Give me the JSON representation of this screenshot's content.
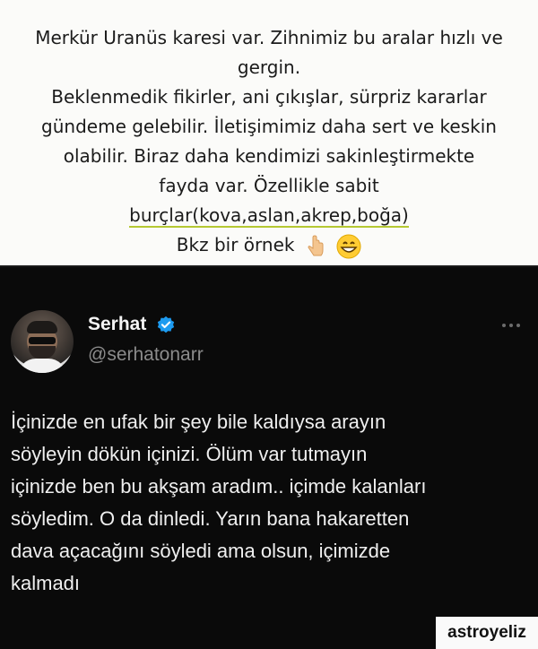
{
  "top_card": {
    "line1": "Merkür Uranüs karesi var. Zihnimiz bu aralar hızlı ve",
    "line2": "gergin.",
    "line3": "Beklenmedik fikirler, ani çıkışlar, sürpriz kararlar",
    "line4": "gündeme gelebilir. İletişimimiz daha sert ve keskin",
    "line5": "olabilir. Biraz daha kendimizi sakinleştirmekte",
    "line6": "fayda var. Özellikle sabit",
    "line7": "burçlar(kova,aslan,akrep,boğa)",
    "line8": "Bkz bir örnek",
    "emoji1": "point-down-emoji",
    "emoji2": "grinning-emoji",
    "underline_color": "#b5c832"
  },
  "tweet": {
    "name": "Serhat",
    "handle": "@serhatonarr",
    "lines": [
      "İçinizde en ufak bir şey bile kaldıysa arayın",
      "söyleyin dökün içinizi. Ölüm var tutmayın",
      "içinizde ben bu akşam aradım.. içimde kalanları",
      "söyledim. O da dinledi. Yarın bana hakaretten",
      "dava açacağını söyledi ama olsun, içimizde",
      "kalmadı"
    ],
    "verified_color": "#1d9bf0"
  },
  "watermark": "astroyeliz"
}
